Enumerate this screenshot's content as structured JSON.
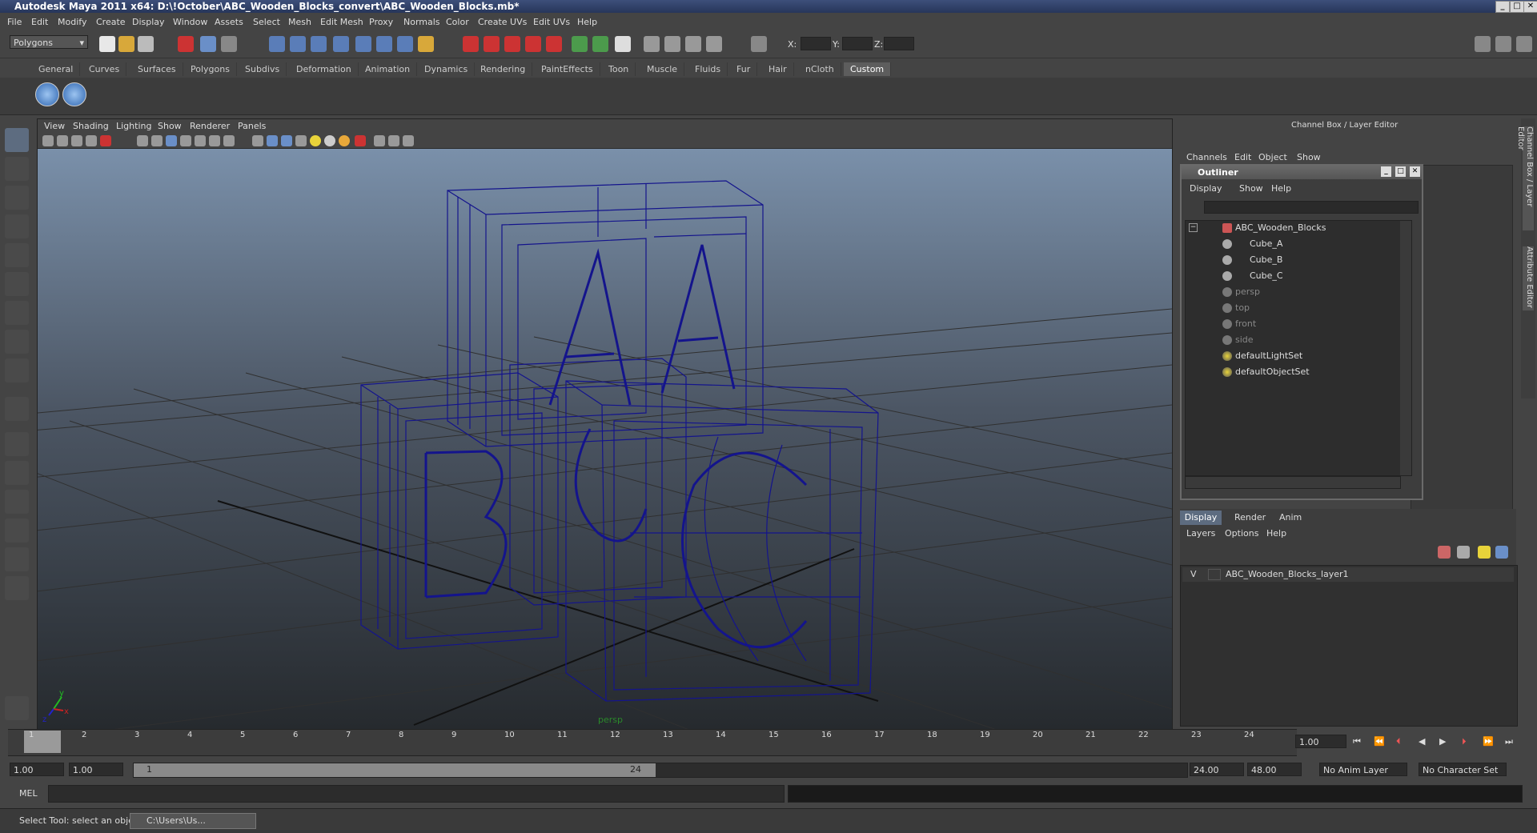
{
  "window": {
    "title": "Autodesk Maya 2011 x64: D:\\!October\\ABC_Wooden_Blocks_convert\\ABC_Wooden_Blocks.mb*"
  },
  "menubar": [
    "File",
    "Edit",
    "Modify",
    "Create",
    "Display",
    "Window",
    "Assets",
    "Select",
    "Mesh",
    "Edit Mesh",
    "Proxy",
    "Normals",
    "Color",
    "Create UVs",
    "Edit UVs",
    "Help"
  ],
  "status": {
    "mode": "Polygons",
    "x_label": "X:",
    "y_label": "Y:",
    "z_label": "Z:"
  },
  "shelf_tabs": [
    "General",
    "Curves",
    "Surfaces",
    "Polygons",
    "Subdivs",
    "Deformation",
    "Animation",
    "Dynamics",
    "Rendering",
    "PaintEffects",
    "Toon",
    "Muscle",
    "Fluids",
    "Fur",
    "Hair",
    "nCloth",
    "Custom"
  ],
  "viewport": {
    "menu": [
      "View",
      "Shading",
      "Lighting",
      "Show",
      "Renderer",
      "Panels"
    ],
    "camera_label": "persp"
  },
  "channel_box": {
    "title": "Channel Box / Layer Editor",
    "menu": [
      "Channels",
      "Edit",
      "Object",
      "Show"
    ],
    "side_tabs": [
      "Channel Box / Layer Editor",
      "Attribute Editor"
    ]
  },
  "outliner": {
    "title": "Outliner",
    "menu": [
      "Display",
      "Show",
      "Help"
    ],
    "items": [
      {
        "label": "ABC_Wooden_Blocks",
        "dim": false
      },
      {
        "label": "Cube_A",
        "dim": false
      },
      {
        "label": "Cube_B",
        "dim": false
      },
      {
        "label": "Cube_C",
        "dim": false
      },
      {
        "label": "persp",
        "dim": true
      },
      {
        "label": "top",
        "dim": true
      },
      {
        "label": "front",
        "dim": true
      },
      {
        "label": "side",
        "dim": true
      },
      {
        "label": "defaultLightSet",
        "dim": false
      },
      {
        "label": "defaultObjectSet",
        "dim": false
      }
    ]
  },
  "layer_editor": {
    "tabs": [
      "Display",
      "Render",
      "Anim"
    ],
    "menu": [
      "Layers",
      "Options",
      "Help"
    ],
    "layer": {
      "visible": "V",
      "name": "ABC_Wooden_Blocks_layer1"
    }
  },
  "timeline": {
    "ticks": [
      "1",
      "2",
      "3",
      "4",
      "5",
      "6",
      "7",
      "8",
      "9",
      "10",
      "11",
      "12",
      "13",
      "14",
      "15",
      "16",
      "17",
      "18",
      "19",
      "20",
      "21",
      "22",
      "23",
      "24"
    ],
    "current_frame": "1.00"
  },
  "range": {
    "start": "1.00",
    "playback_start": "1.00",
    "slider_start": "1",
    "slider_end": "24",
    "playback_end": "24.00",
    "end": "48.00",
    "anim_layer": "No Anim Layer",
    "character_set": "No Character Set"
  },
  "command": {
    "label": "MEL"
  },
  "help": {
    "text": "Select Tool: select an object",
    "taskbar": "C:\\Users\\Us..."
  },
  "colors": {
    "wire": "#14148c",
    "accent": "#5d5d5d"
  }
}
